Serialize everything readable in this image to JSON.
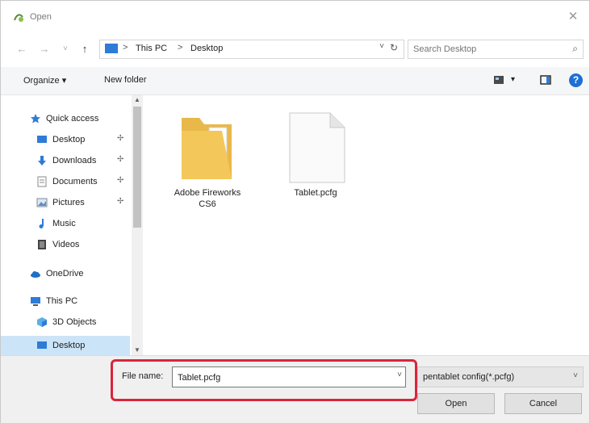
{
  "window": {
    "title": "Open",
    "close_glyph": "✕"
  },
  "nav": {
    "back_glyph": "←",
    "forward_glyph": "→",
    "recent_glyph": "˅",
    "up_glyph": "↑",
    "breadcrumbs": [
      "This PC",
      "Desktop"
    ],
    "sep_glyph": ">",
    "dropdown_glyph": "˅",
    "refresh_glyph": "↻"
  },
  "search": {
    "placeholder": "Search Desktop",
    "icon_glyph": "⌕"
  },
  "toolbar": {
    "organize_label": "Organize ▾",
    "new_folder_label": "New folder",
    "view_dd_glyph": "▾",
    "help_glyph": "?"
  },
  "sidebar": {
    "items": [
      {
        "label": "Quick access",
        "icon": "star-icon",
        "pinned": false
      },
      {
        "label": "Desktop",
        "icon": "desktop-icon",
        "pinned": true
      },
      {
        "label": "Downloads",
        "icon": "download-icon",
        "pinned": true
      },
      {
        "label": "Documents",
        "icon": "document-icon",
        "pinned": true
      },
      {
        "label": "Pictures",
        "icon": "pictures-icon",
        "pinned": true
      },
      {
        "label": "Music",
        "icon": "music-icon",
        "pinned": false
      },
      {
        "label": "Videos",
        "icon": "videos-icon",
        "pinned": false
      },
      {
        "label": "OneDrive",
        "icon": "cloud-icon",
        "pinned": false
      },
      {
        "label": "This PC",
        "icon": "computer-icon",
        "pinned": false
      },
      {
        "label": "3D Objects",
        "icon": "cube-icon",
        "pinned": false
      },
      {
        "label": "Desktop",
        "icon": "desktop-icon",
        "pinned": false,
        "selected": true
      }
    ],
    "pin_glyph": "✢"
  },
  "files": [
    {
      "name": "Adobe Fireworks CS6",
      "type": "folder"
    },
    {
      "name": "Tablet.pcfg",
      "type": "file"
    }
  ],
  "footer": {
    "filename_label": "File name:",
    "filename_value": "Tablet.pcfg",
    "filter_label": "pentablet config(*.pcfg)",
    "dd_glyph": "˅",
    "open_label": "Open",
    "cancel_label": "Cancel"
  },
  "colors": {
    "accent": "#2f7bd8",
    "highlight": "#d9253c",
    "selection": "#cce4f7",
    "folder": "#f3c75a"
  }
}
